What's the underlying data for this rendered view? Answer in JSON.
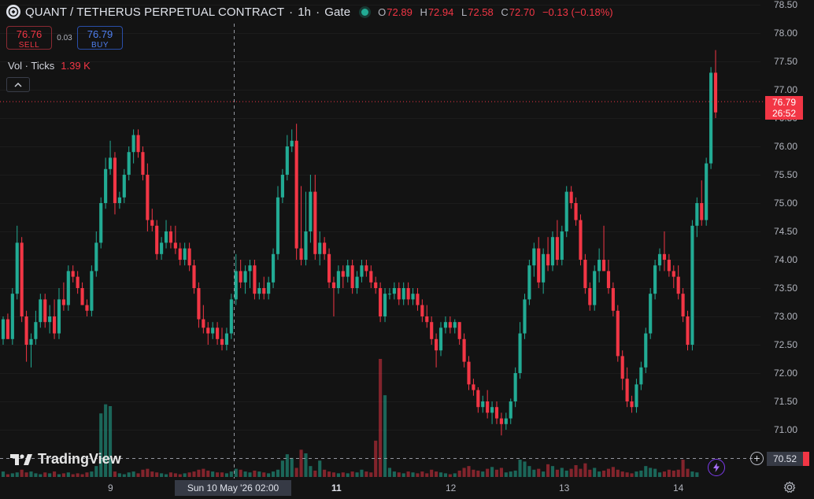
{
  "header": {
    "symbol_title": "QUANT / TETHERUS PERPETUAL CONTRACT",
    "sep1": "·",
    "interval": "1h",
    "sep2": "·",
    "exchange": "Gate",
    "ohlc": {
      "o_label": "O",
      "o": "72.89",
      "h_label": "H",
      "h": "72.94",
      "l_label": "L",
      "l": "72.58",
      "c_label": "C",
      "c": "72.70",
      "change": "−0.13 (−0.18%)"
    },
    "status_color": "#22ab94"
  },
  "trade": {
    "sell_price": "76.76",
    "sell_label": "SELL",
    "spread": "0.03",
    "buy_price": "76.79",
    "buy_label": "BUY"
  },
  "volume_legend": {
    "label": "Vol · Ticks",
    "value": "1.39 K"
  },
  "watermark": "TradingView",
  "price_scale": [
    "78.50",
    "78.00",
    "77.50",
    "77.00",
    "76.50",
    "76.00",
    "75.50",
    "75.00",
    "74.50",
    "74.00",
    "73.50",
    "73.00",
    "72.50",
    "72.00",
    "71.50",
    "71.00"
  ],
  "time_scale": {
    "labels": [
      "9",
      "11",
      "12",
      "13",
      "14"
    ],
    "bold": [
      "11"
    ]
  },
  "current_price": {
    "price": "76.79",
    "countdown": "26:52"
  },
  "crosshair": {
    "price": "70.52",
    "date": "Sun 10 May '26   02:00"
  },
  "icons": [
    "logo-icon",
    "collapse-chevron-icon",
    "plus-circle-icon",
    "lightning-icon",
    "gear-icon"
  ],
  "colors": {
    "up": "#22ab94",
    "down": "#f23645",
    "background": "#131313"
  },
  "chart_data": {
    "type": "candlestick",
    "interval": "1h",
    "y_range": [
      70.8,
      78.6
    ],
    "candles": [
      [
        72.6,
        73.0,
        72.5,
        72.95
      ],
      [
        72.95,
        73.05,
        72.6,
        72.6
      ],
      [
        72.6,
        73.5,
        72.5,
        73.4
      ],
      [
        73.4,
        74.6,
        73.3,
        74.3
      ],
      [
        74.3,
        74.4,
        72.9,
        73.0
      ],
      [
        73.0,
        73.1,
        72.2,
        72.5
      ],
      [
        72.5,
        72.7,
        72.1,
        72.6
      ],
      [
        72.6,
        73.1,
        72.5,
        72.9
      ],
      [
        72.9,
        73.4,
        72.8,
        73.3
      ],
      [
        73.3,
        73.4,
        72.8,
        72.9
      ],
      [
        72.9,
        73.2,
        72.7,
        73.0
      ],
      [
        73.0,
        73.3,
        72.6,
        72.7
      ],
      [
        72.7,
        73.5,
        72.6,
        73.3
      ],
      [
        73.3,
        73.6,
        73.1,
        73.2
      ],
      [
        73.2,
        73.9,
        73.1,
        73.8
      ],
      [
        73.8,
        73.9,
        73.6,
        73.7
      ],
      [
        73.7,
        73.8,
        73.4,
        73.5
      ],
      [
        73.5,
        73.6,
        73.2,
        73.2
      ],
      [
        73.2,
        73.3,
        73.0,
        73.1
      ],
      [
        73.1,
        73.9,
        73.0,
        73.8
      ],
      [
        73.8,
        74.5,
        73.7,
        74.3
      ],
      [
        74.3,
        75.1,
        74.2,
        75.0
      ],
      [
        75.0,
        75.8,
        74.9,
        75.6
      ],
      [
        75.6,
        76.1,
        75.5,
        75.8
      ],
      [
        75.8,
        75.9,
        74.8,
        75.0
      ],
      [
        75.0,
        75.2,
        74.9,
        75.1
      ],
      [
        75.1,
        75.6,
        75.0,
        75.5
      ],
      [
        75.5,
        76.0,
        75.4,
        75.9
      ],
      [
        75.9,
        76.3,
        75.7,
        76.2
      ],
      [
        76.2,
        76.3,
        75.8,
        75.9
      ],
      [
        75.9,
        76.0,
        75.4,
        75.5
      ],
      [
        75.5,
        75.7,
        74.5,
        74.7
      ],
      [
        74.7,
        74.9,
        74.5,
        74.6
      ],
      [
        74.6,
        74.7,
        74.0,
        74.1
      ],
      [
        74.1,
        74.4,
        74.0,
        74.3
      ],
      [
        74.3,
        74.7,
        74.2,
        74.5
      ],
      [
        74.5,
        74.6,
        74.2,
        74.3
      ],
      [
        74.3,
        74.6,
        74.1,
        74.2
      ],
      [
        74.2,
        74.3,
        73.9,
        74.0
      ],
      [
        74.0,
        74.3,
        73.9,
        74.2
      ],
      [
        74.2,
        74.3,
        73.8,
        73.9
      ],
      [
        73.9,
        74.0,
        73.4,
        73.5
      ],
      [
        73.5,
        73.6,
        72.8,
        72.95
      ],
      [
        72.95,
        73.2,
        72.7,
        72.8
      ],
      [
        72.8,
        72.9,
        72.5,
        72.7
      ],
      [
        72.7,
        72.9,
        72.6,
        72.8
      ],
      [
        72.8,
        72.9,
        72.5,
        72.6
      ],
      [
        72.6,
        72.8,
        72.4,
        72.5
      ],
      [
        72.5,
        72.8,
        72.4,
        72.7
      ],
      [
        72.7,
        73.4,
        72.6,
        73.3
      ],
      [
        73.3,
        74.1,
        73.2,
        73.8
      ],
      [
        73.8,
        74.0,
        73.5,
        73.6
      ],
      [
        73.6,
        73.9,
        73.4,
        73.8
      ],
      [
        73.8,
        74.0,
        73.5,
        73.9
      ],
      [
        73.9,
        74.0,
        73.3,
        73.4
      ],
      [
        73.4,
        73.6,
        73.3,
        73.5
      ],
      [
        73.5,
        73.7,
        73.3,
        73.4
      ],
      [
        73.4,
        73.7,
        73.3,
        73.6
      ],
      [
        73.6,
        74.2,
        73.5,
        74.1
      ],
      [
        74.1,
        75.3,
        74.0,
        75.1
      ],
      [
        75.1,
        75.6,
        75.0,
        75.5
      ],
      [
        75.5,
        76.2,
        75.4,
        76.0
      ],
      [
        76.0,
        76.3,
        75.9,
        76.1
      ],
      [
        76.1,
        76.4,
        74.0,
        74.2
      ],
      [
        74.2,
        75.3,
        73.9,
        74.0
      ],
      [
        74.0,
        75.2,
        73.9,
        74.5
      ],
      [
        74.5,
        75.5,
        74.3,
        75.2
      ],
      [
        75.2,
        75.5,
        74.0,
        74.1
      ],
      [
        74.1,
        74.5,
        73.9,
        74.3
      ],
      [
        74.3,
        74.4,
        74.0,
        74.1
      ],
      [
        74.1,
        74.2,
        73.5,
        73.6
      ],
      [
        73.6,
        73.7,
        73.0,
        73.5
      ],
      [
        73.5,
        73.9,
        73.4,
        73.8
      ],
      [
        73.8,
        73.9,
        73.5,
        73.7
      ],
      [
        73.7,
        74.0,
        73.6,
        73.9
      ],
      [
        73.9,
        74.0,
        73.4,
        73.5
      ],
      [
        73.5,
        73.8,
        73.4,
        73.7
      ],
      [
        73.7,
        74.0,
        73.6,
        73.9
      ],
      [
        73.9,
        74.0,
        73.7,
        73.8
      ],
      [
        73.8,
        73.9,
        73.5,
        73.6
      ],
      [
        73.6,
        73.7,
        73.4,
        73.5
      ],
      [
        73.5,
        73.6,
        72.9,
        73.0
      ],
      [
        73.0,
        73.5,
        72.9,
        73.4
      ],
      [
        73.4,
        73.5,
        73.3,
        73.4
      ],
      [
        73.4,
        73.6,
        73.3,
        73.5
      ],
      [
        73.5,
        73.6,
        73.2,
        73.3
      ],
      [
        73.3,
        73.6,
        73.2,
        73.5
      ],
      [
        73.5,
        73.6,
        73.2,
        73.3
      ],
      [
        73.3,
        73.5,
        73.2,
        73.4
      ],
      [
        73.4,
        73.5,
        73.1,
        73.2
      ],
      [
        73.2,
        73.3,
        72.9,
        73.0
      ],
      [
        73.0,
        73.2,
        72.8,
        72.9
      ],
      [
        72.9,
        73.0,
        72.5,
        72.6
      ],
      [
        72.6,
        72.7,
        72.1,
        72.4
      ],
      [
        72.4,
        72.9,
        72.3,
        72.8
      ],
      [
        72.8,
        73.0,
        72.7,
        72.9
      ],
      [
        72.9,
        73.0,
        72.7,
        72.8
      ],
      [
        72.8,
        72.95,
        72.7,
        72.9
      ],
      [
        72.9,
        72.9,
        72.5,
        72.6
      ],
      [
        72.6,
        72.7,
        72.1,
        72.2
      ],
      [
        72.2,
        72.3,
        71.7,
        71.8
      ],
      [
        71.8,
        71.9,
        71.6,
        71.7
      ],
      [
        71.7,
        71.75,
        71.3,
        71.4
      ],
      [
        71.4,
        71.6,
        71.3,
        71.5
      ],
      [
        71.5,
        71.7,
        71.2,
        71.3
      ],
      [
        71.3,
        71.5,
        71.1,
        71.4
      ],
      [
        71.4,
        71.5,
        71.1,
        71.2
      ],
      [
        71.2,
        71.3,
        70.9,
        71.1
      ],
      [
        71.1,
        71.3,
        71.0,
        71.2
      ],
      [
        71.2,
        71.55,
        71.1,
        71.5
      ],
      [
        71.5,
        72.1,
        71.4,
        72.0
      ],
      [
        72.0,
        72.9,
        71.9,
        72.7
      ],
      [
        72.7,
        73.4,
        72.6,
        73.3
      ],
      [
        73.3,
        74.0,
        73.2,
        73.9
      ],
      [
        73.9,
        74.3,
        73.7,
        74.2
      ],
      [
        74.2,
        74.4,
        73.5,
        73.6
      ],
      [
        73.6,
        74.2,
        73.4,
        74.1
      ],
      [
        74.1,
        74.4,
        73.8,
        73.9
      ],
      [
        73.9,
        74.5,
        73.8,
        74.4
      ],
      [
        74.4,
        74.7,
        73.9,
        74.0
      ],
      [
        74.0,
        74.6,
        73.9,
        74.5
      ],
      [
        74.5,
        75.3,
        74.4,
        75.2
      ],
      [
        75.2,
        75.3,
        74.9,
        75.0
      ],
      [
        75.0,
        75.1,
        74.6,
        74.7
      ],
      [
        74.7,
        74.8,
        73.9,
        74.0
      ],
      [
        74.0,
        74.1,
        73.4,
        73.5
      ],
      [
        73.5,
        73.6,
        73.1,
        73.2
      ],
      [
        73.2,
        73.9,
        73.1,
        73.8
      ],
      [
        73.8,
        74.2,
        73.6,
        74.0
      ],
      [
        74.0,
        74.6,
        73.8,
        73.8
      ],
      [
        73.8,
        74.0,
        73.4,
        73.5
      ],
      [
        73.5,
        73.6,
        73.0,
        73.1
      ],
      [
        73.1,
        73.2,
        72.2,
        72.3
      ],
      [
        72.3,
        72.4,
        71.7,
        71.9
      ],
      [
        71.9,
        72.1,
        71.4,
        71.5
      ],
      [
        71.5,
        71.6,
        71.3,
        71.4
      ],
      [
        71.4,
        71.9,
        71.3,
        71.8
      ],
      [
        71.8,
        72.2,
        71.7,
        72.1
      ],
      [
        72.1,
        72.8,
        72.0,
        72.7
      ],
      [
        72.7,
        73.5,
        72.6,
        73.4
      ],
      [
        73.4,
        74.0,
        73.3,
        73.9
      ],
      [
        73.9,
        74.2,
        73.8,
        74.1
      ],
      [
        74.1,
        74.5,
        73.8,
        74.0
      ],
      [
        74.0,
        74.1,
        73.7,
        73.8
      ],
      [
        73.8,
        73.9,
        73.5,
        73.7
      ],
      [
        73.7,
        73.9,
        73.3,
        73.4
      ],
      [
        73.4,
        73.5,
        72.9,
        73.0
      ],
      [
        73.0,
        73.1,
        72.4,
        72.5
      ],
      [
        72.5,
        74.7,
        72.4,
        74.6
      ],
      [
        74.6,
        75.1,
        74.4,
        75.0
      ],
      [
        75.0,
        75.4,
        74.6,
        74.7
      ],
      [
        74.7,
        75.8,
        74.6,
        75.7
      ],
      [
        75.7,
        77.4,
        75.6,
        77.3
      ],
      [
        77.3,
        77.7,
        76.5,
        76.6
      ]
    ],
    "volume": [
      6,
      3,
      4,
      5,
      8,
      5,
      6,
      4,
      3,
      5,
      4,
      6,
      3,
      4,
      5,
      3,
      4,
      3,
      5,
      6,
      12,
      70,
      80,
      78,
      6,
      4,
      3,
      5,
      6,
      4,
      8,
      9,
      6,
      5,
      4,
      3,
      5,
      4,
      3,
      4,
      5,
      6,
      8,
      9,
      7,
      6,
      5,
      5,
      4,
      6,
      9,
      8,
      6,
      5,
      7,
      6,
      5,
      4,
      6,
      8,
      18,
      25,
      21,
      10,
      30,
      26,
      12,
      7,
      18,
      8,
      6,
      5,
      4,
      5,
      4,
      6,
      5,
      8,
      6,
      5,
      40,
      130,
      90,
      10,
      6,
      5,
      4,
      6,
      5,
      4,
      6,
      4,
      8,
      6,
      5,
      4,
      3,
      4,
      7,
      10,
      12,
      8,
      7,
      6,
      9,
      11,
      8,
      10,
      5,
      6,
      7,
      19,
      17,
      12,
      8,
      9,
      6,
      14,
      12,
      8,
      10,
      7,
      9,
      13,
      9,
      15,
      8,
      10,
      6,
      7,
      9,
      11,
      8,
      6,
      5,
      4,
      6,
      7,
      12,
      10,
      9,
      5,
      6,
      8,
      7,
      8,
      19,
      9,
      6,
      5
    ]
  }
}
